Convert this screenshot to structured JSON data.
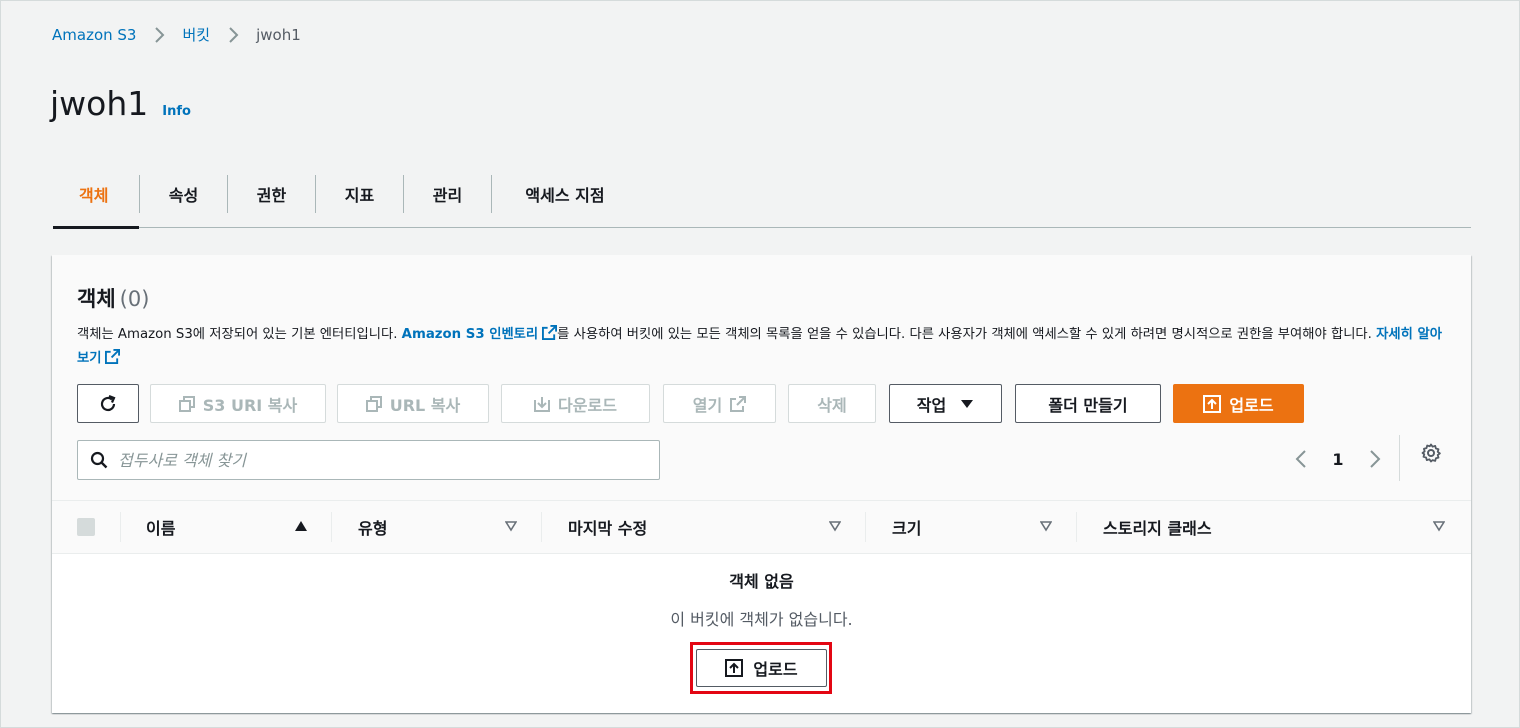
{
  "breadcrumb": {
    "root": "Amazon S3",
    "buckets": "버킷",
    "current": "jwoh1"
  },
  "page": {
    "title": "jwoh1",
    "info": "Info"
  },
  "tabs": [
    {
      "label": "객체",
      "active": true
    },
    {
      "label": "속성"
    },
    {
      "label": "권한"
    },
    {
      "label": "지표"
    },
    {
      "label": "관리"
    },
    {
      "label": "액세스 지점"
    }
  ],
  "objects": {
    "title": "객체",
    "count": "(0)",
    "desc_part1": "객체는 Amazon S3에 저장되어 있는 기본 엔터티입니다.",
    "desc_link1": "Amazon S3 인벤토리",
    "desc_part2": "를 사용하여 버킷에 있는 모든 객체의 목록을 얻을 수 있습니다. 다른 사용자가 객체에 액세스할 수 있게 하려면 명시적으로 권한을 부여해야 합니다.",
    "desc_link2": "자세히 알아보기"
  },
  "toolbar": {
    "copy_s3_uri": "S3 URI 복사",
    "copy_url": "URL 복사",
    "download": "다운로드",
    "open": "열기",
    "delete": "삭제",
    "actions": "작업",
    "create_folder": "폴더 만들기",
    "upload": "업로드"
  },
  "search": {
    "placeholder": "접두사로 객체 찾기"
  },
  "pagination": {
    "page": "1"
  },
  "table": {
    "columns": [
      "이름",
      "유형",
      "마지막 수정",
      "크기",
      "스토리지 클래스"
    ]
  },
  "empty": {
    "title": "객체 없음",
    "desc": "이 버킷에 객체가 없습니다.",
    "upload": "업로드"
  },
  "colors": {
    "accent": "#ec7211",
    "link": "#0073bb",
    "highlight": "#e30613"
  }
}
